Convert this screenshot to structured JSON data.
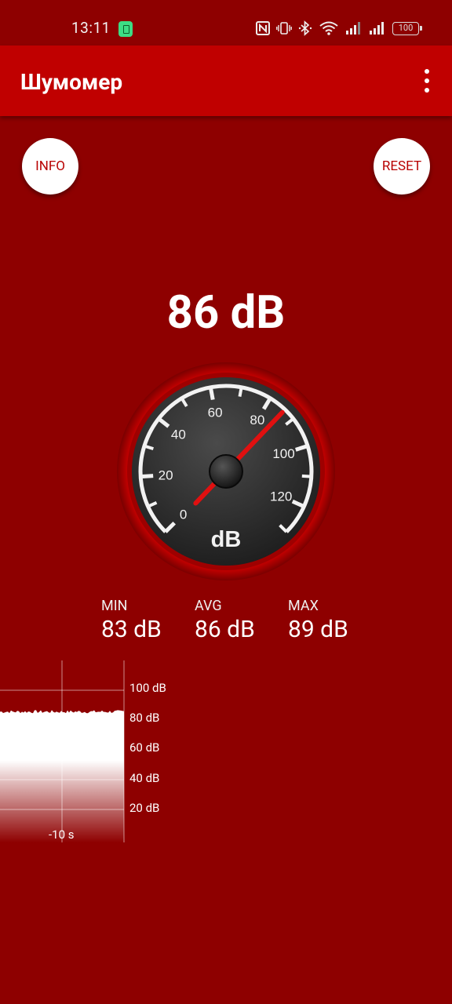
{
  "status_bar": {
    "time": "13:11",
    "battery": "100",
    "icons": [
      "notification-icon",
      "nfc-icon",
      "vibrate-icon",
      "bluetooth-icon",
      "wifi-icon",
      "signal-icon",
      "signal-icon",
      "battery-icon"
    ]
  },
  "app_bar": {
    "title": "Шумомер",
    "menu_icon": "more-vert-icon"
  },
  "buttons": {
    "info": "INFO",
    "reset": "RESET"
  },
  "reading": "86 dB",
  "gauge": {
    "value": 86,
    "min": 0,
    "max": 130,
    "unit": "dB",
    "labels": [
      "0",
      "20",
      "40",
      "60",
      "80",
      "100",
      "120"
    ]
  },
  "stats": {
    "min_label": "MIN",
    "min_value": "83 dB",
    "avg_label": "AVG",
    "avg_value": "86 dB",
    "max_label": "MAX",
    "max_value": "89 dB"
  },
  "history": {
    "y_labels": [
      "100 dB",
      "80 dB",
      "60 dB",
      "40 dB",
      "20 dB"
    ],
    "x_label": "-10 s"
  },
  "colors": {
    "background": "#8e0000",
    "app_bar": "#c00000",
    "needle": "#e01010",
    "accent_text": "#b80000"
  }
}
